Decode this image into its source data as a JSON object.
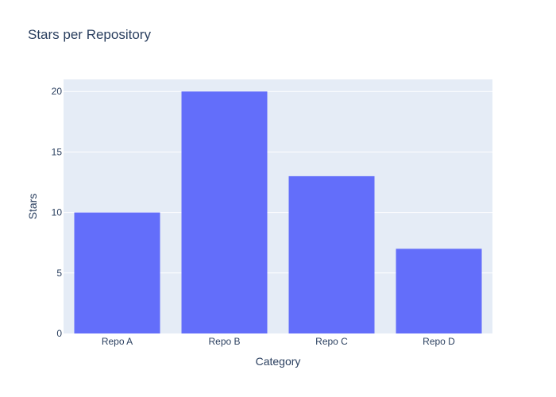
{
  "chart_data": {
    "type": "bar",
    "title": "Stars per Repository",
    "xlabel": "Category",
    "ylabel": "Stars",
    "categories": [
      "Repo A",
      "Repo B",
      "Repo C",
      "Repo D"
    ],
    "values": [
      10,
      20,
      13,
      7
    ],
    "ylim": [
      0,
      21
    ],
    "yticks": [
      0,
      5,
      10,
      15,
      20
    ],
    "grid": true,
    "legend": "none",
    "colors": {
      "bar": "#636efa",
      "plot_background": "#e5ecf6",
      "gridline": "#ffffff",
      "text": "#2a3f5f"
    }
  }
}
